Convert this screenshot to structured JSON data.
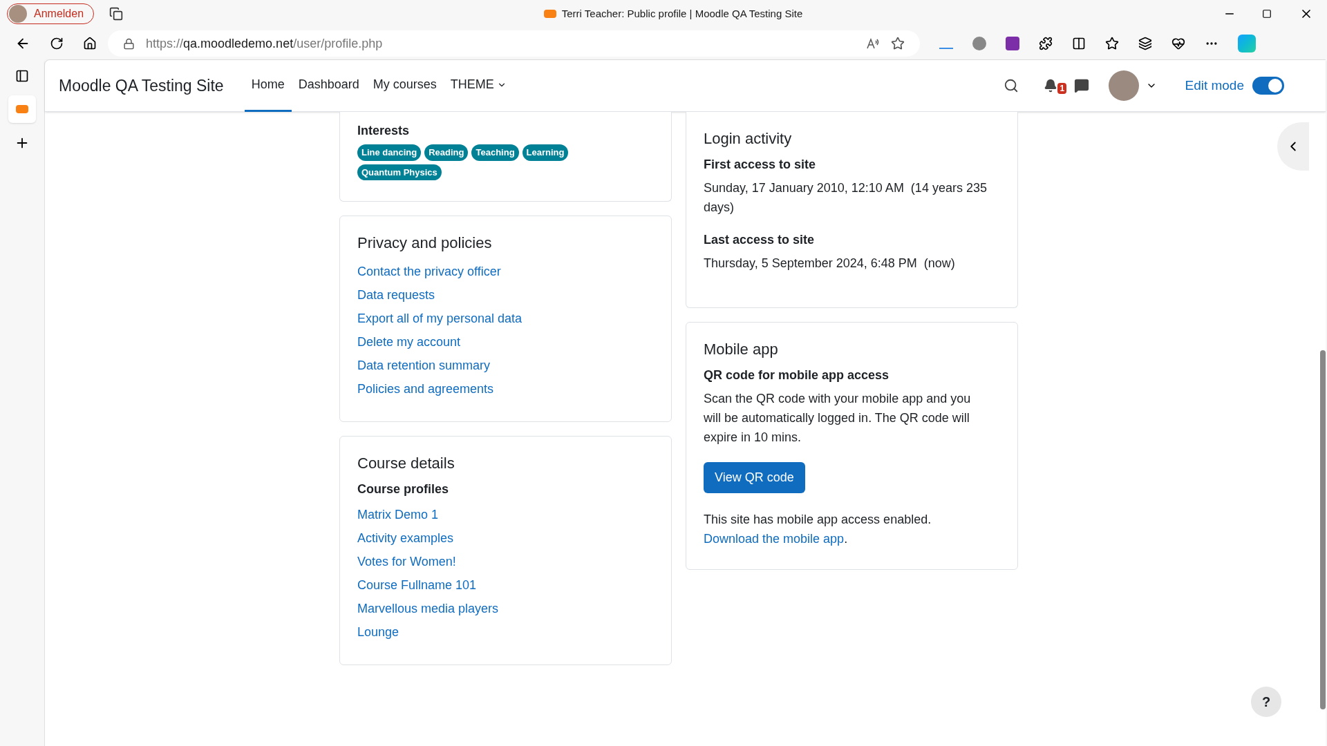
{
  "browser": {
    "profile_button": "Anmelden",
    "title": "Terri Teacher: Public profile | Moodle QA Testing Site",
    "url_host": "qa.moodledemo.net",
    "url_scheme": "https://",
    "url_path": "/user/profile.php"
  },
  "site_nav": {
    "site_name": "Moodle QA Testing Site",
    "items": [
      {
        "label": "Home",
        "selected": true,
        "kind": "link"
      },
      {
        "label": "Dashboard",
        "selected": false,
        "kind": "link"
      },
      {
        "label": "My courses",
        "selected": false,
        "kind": "link"
      },
      {
        "label": "THEME",
        "selected": false,
        "kind": "dropdown"
      }
    ],
    "notification_count": "1",
    "edit_mode": {
      "label": "Edit mode",
      "on": true
    }
  },
  "interests": {
    "heading": "Interests",
    "tags": [
      "Line dancing",
      "Reading",
      "Teaching",
      "Learning",
      "Quantum Physics"
    ]
  },
  "privacy": {
    "heading": "Privacy and policies",
    "links": [
      "Contact the privacy officer",
      "Data requests",
      "Export all of my personal data",
      "Delete my account",
      "Data retention summary",
      "Policies and agreements"
    ]
  },
  "course_details": {
    "heading": "Course details",
    "subheading": "Course profiles",
    "courses": [
      "Matrix Demo 1",
      "Activity examples",
      "Votes for Women!",
      "Course Fullname 101",
      "Marvellous media players",
      "Lounge"
    ]
  },
  "login_activity": {
    "heading": "Login activity",
    "entries": [
      {
        "label": "First access to site",
        "value": "Sunday, 17 January 2010, 12:10 AM  (14 years 235 days)"
      },
      {
        "label": "Last access to site",
        "value": "Thursday, 5 September 2024, 6:48 PM  (now)"
      }
    ]
  },
  "mobile_app": {
    "heading": "Mobile app",
    "subheading": "QR code for mobile app access",
    "description": "Scan the QR code with your mobile app and you will be automatically logged in. The QR code will expire in 10 mins.",
    "button": "View QR code",
    "status": "This site has mobile app access enabled.",
    "link": "Download the mobile app",
    "link_suffix": "."
  },
  "help_button": "?"
}
